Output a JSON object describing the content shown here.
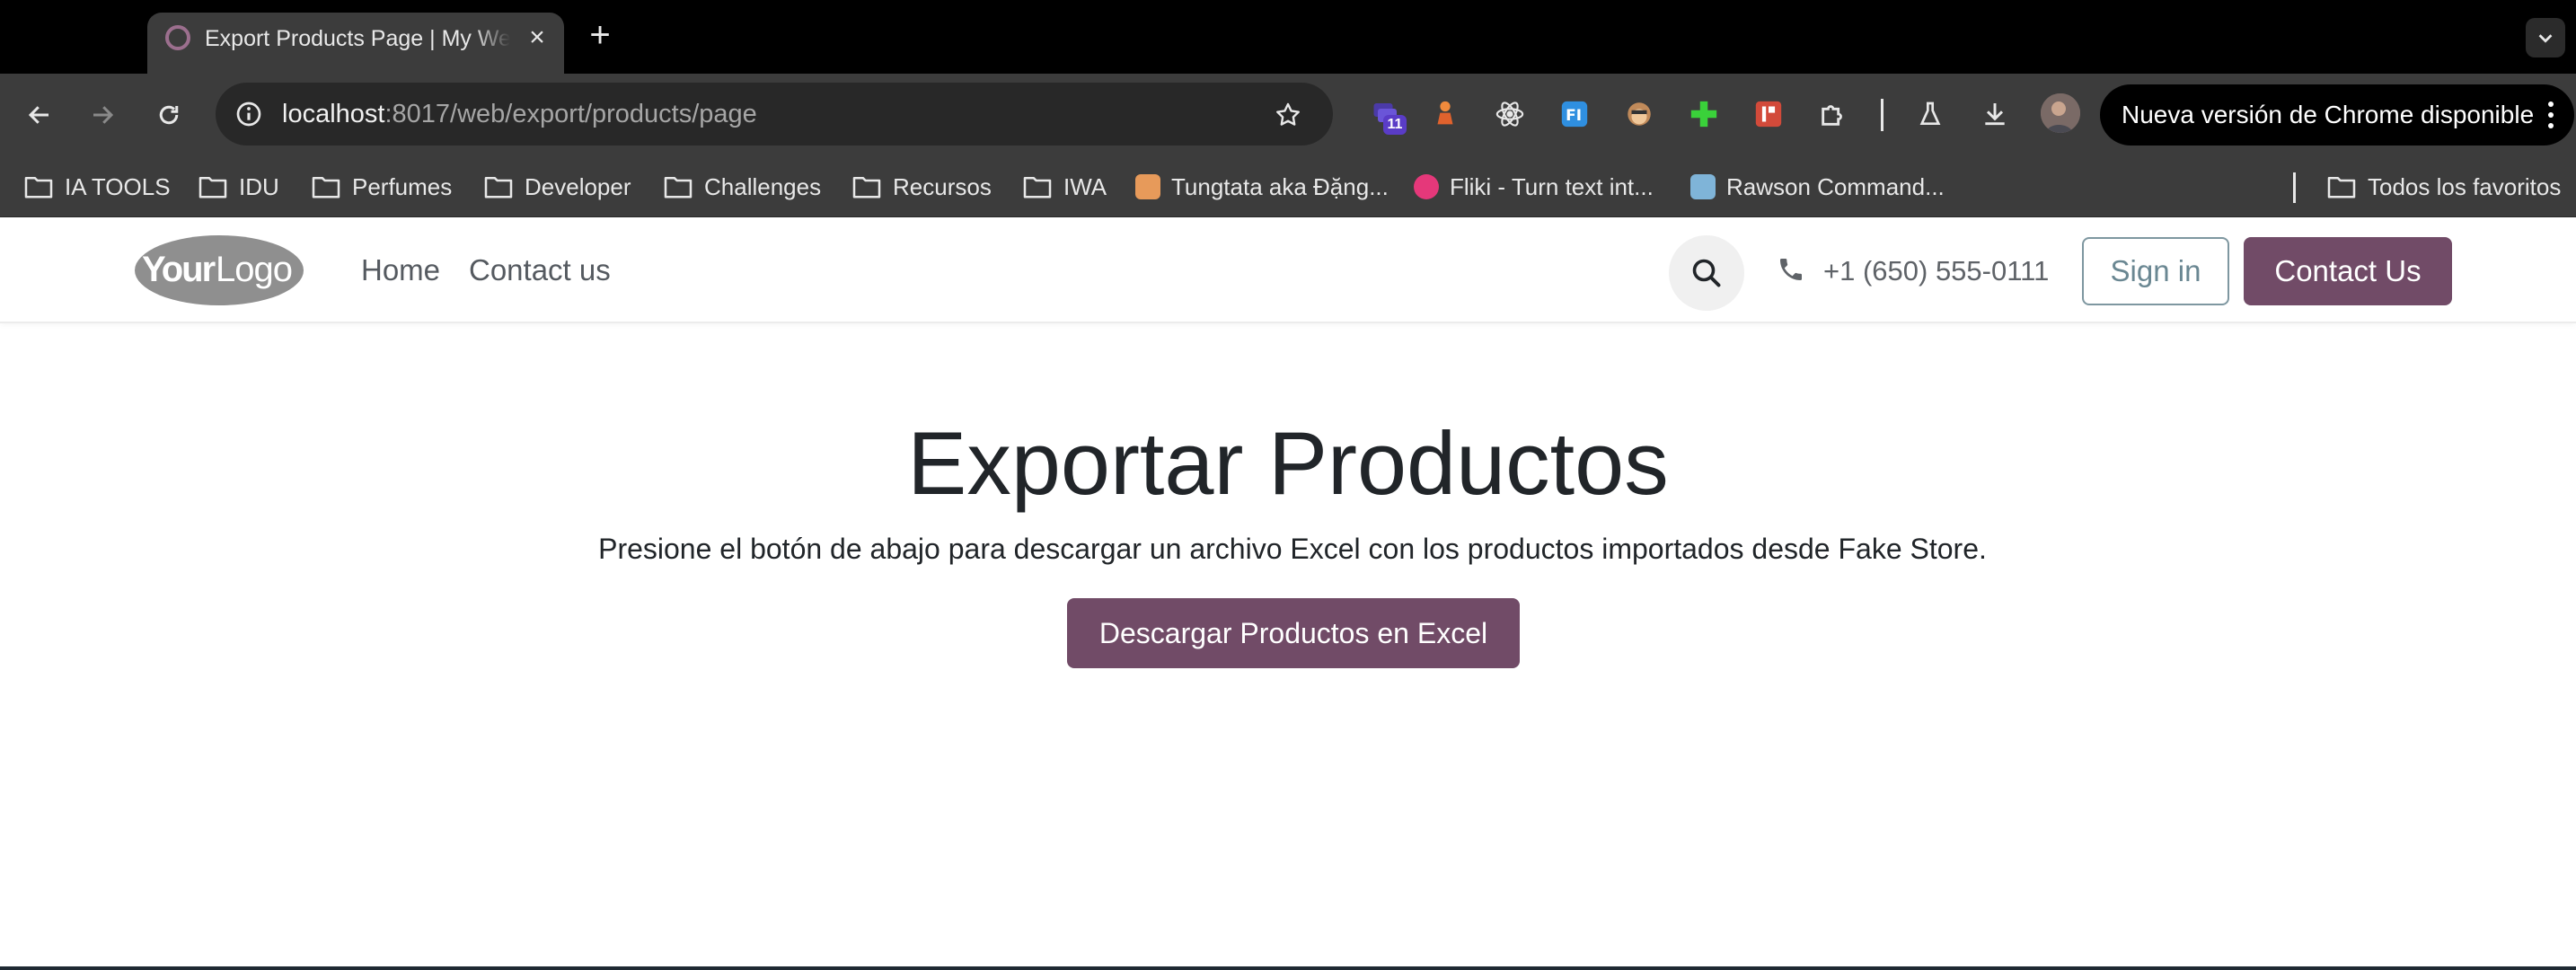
{
  "browser": {
    "tab": {
      "title": "Export Products Page | My Website",
      "favicon": "odoo-circle-icon"
    },
    "url": {
      "host": "localhost",
      "path": ":8017/web/export/products/page"
    },
    "extensions": [
      {
        "name": "stack-extension-icon",
        "badge": "11"
      },
      {
        "name": "chess-pawn-extension-icon"
      },
      {
        "name": "react-devtools-icon"
      },
      {
        "name": "fl-extension-icon"
      },
      {
        "name": "monkey-extension-icon"
      },
      {
        "name": "green-plus-extension-icon"
      },
      {
        "name": "red-square-extension-icon"
      },
      {
        "name": "puzzle-extensions-icon"
      }
    ],
    "update_label": "Nueva versión de Chrome disponible",
    "bookmarks": [
      {
        "label": "IA TOOLS",
        "icon": "folder-icon"
      },
      {
        "label": "IDU",
        "icon": "folder-icon"
      },
      {
        "label": "Perfumes",
        "icon": "folder-icon"
      },
      {
        "label": "Developer",
        "icon": "folder-icon"
      },
      {
        "label": "Challenges",
        "icon": "folder-icon"
      },
      {
        "label": "Recursos",
        "icon": "folder-icon"
      },
      {
        "label": "IWA",
        "icon": "folder-icon"
      },
      {
        "label": "Tungtata aka Đặng...",
        "icon": "site-favicon-icon"
      },
      {
        "label": "Fliki - Turn text int...",
        "icon": "fliki-favicon-icon"
      },
      {
        "label": "Rawson Command...",
        "icon": "rawson-favicon-icon"
      }
    ],
    "all_bookmarks_label": "Todos los favoritos"
  },
  "site": {
    "logo_text": "YourLogo",
    "nav": [
      {
        "label": "Home"
      },
      {
        "label": "Contact us"
      }
    ],
    "phone": "+1 (650) 555-0111",
    "signin_label": "Sign in",
    "contact_label": "Contact Us",
    "colors": {
      "primary": "#714b67",
      "signin_border": "#7e97a0"
    }
  },
  "main": {
    "title": "Exportar Productos",
    "description": "Presione el botón de abajo para descargar un archivo Excel con los productos importados desde Fake Store.",
    "download_label": "Descargar Productos en Excel"
  }
}
